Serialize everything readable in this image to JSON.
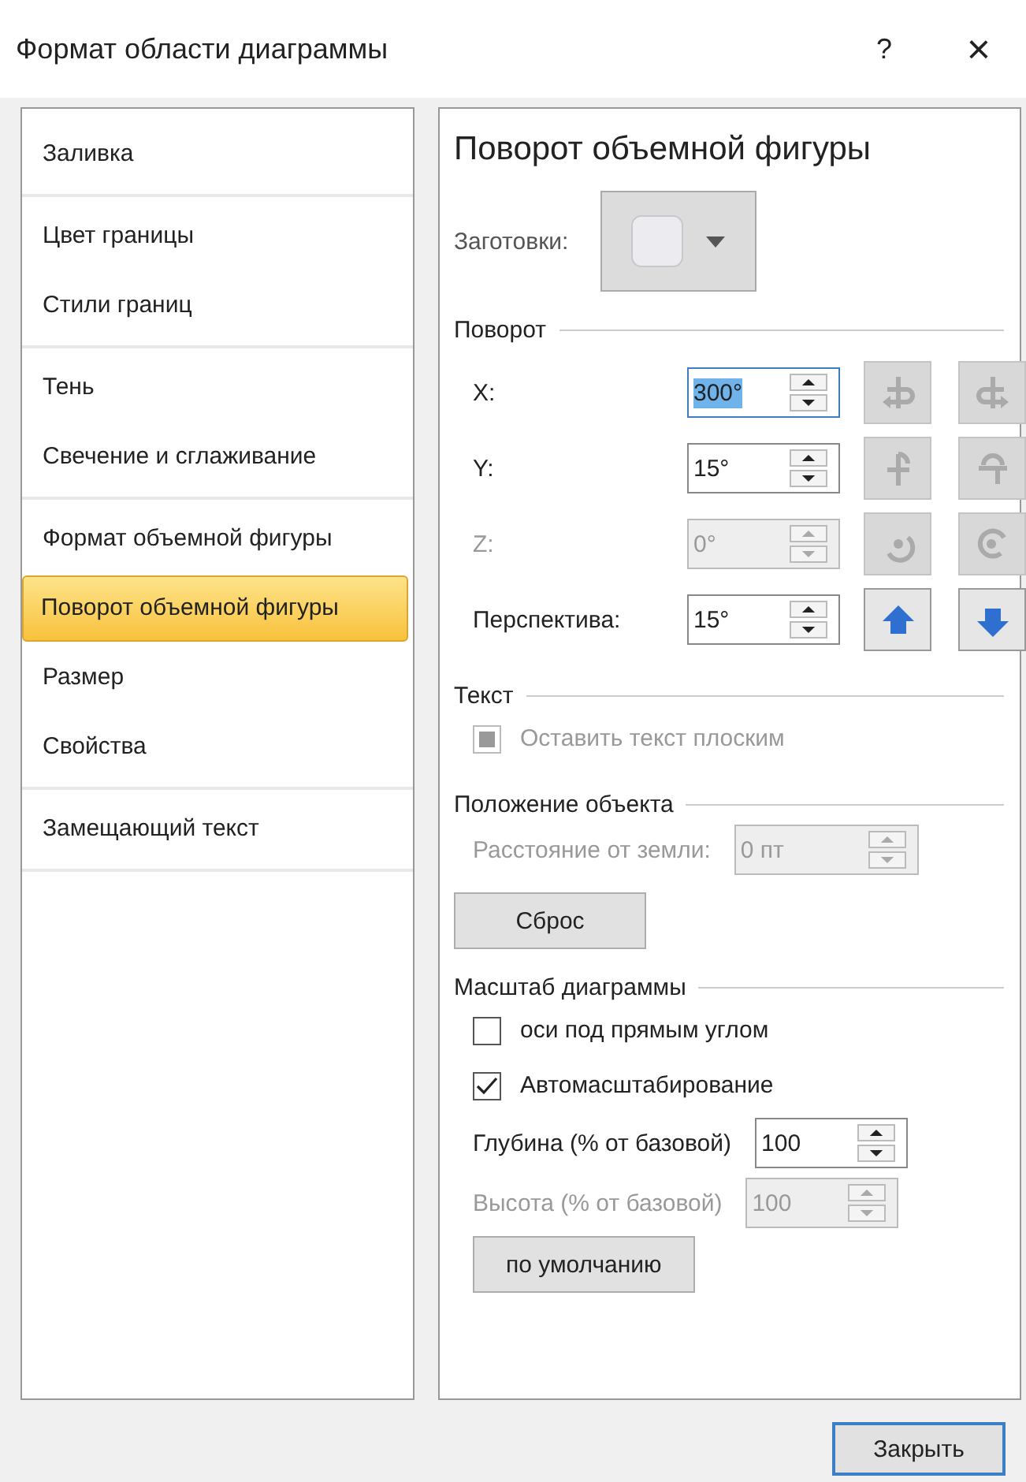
{
  "window": {
    "title": "Формат области диаграммы",
    "help": "?",
    "close": "×"
  },
  "sidebar": {
    "groups": [
      [
        {
          "label": "Заливка",
          "selected": false
        }
      ],
      [
        {
          "label": "Цвет границы",
          "selected": false
        },
        {
          "label": "Стили границ",
          "selected": false
        }
      ],
      [
        {
          "label": "Тень",
          "selected": false
        },
        {
          "label": "Свечение и сглаживание",
          "selected": false
        }
      ],
      [
        {
          "label": "Формат объемной фигуры",
          "selected": false
        },
        {
          "label": "Поворот объемной фигуры",
          "selected": true
        },
        {
          "label": "Размер",
          "selected": false
        },
        {
          "label": "Свойства",
          "selected": false
        }
      ],
      [
        {
          "label": "Замещающий текст",
          "selected": false
        }
      ]
    ]
  },
  "panel": {
    "title": "Поворот объемной фигуры",
    "presets": {
      "label": "Заготовки:"
    },
    "sections": [
      {
        "title": "Поворот",
        "items": [
          {
            "kind": "rotation_x",
            "label": "X:",
            "value": "300°",
            "value_selected": true,
            "disabled": false,
            "buttons_disabled": true
          },
          {
            "kind": "rotation_y",
            "label": "Y:",
            "value": "15°",
            "value_selected": false,
            "disabled": false,
            "buttons_disabled": true
          },
          {
            "kind": "rotation_z",
            "label": "Z:",
            "value": "0°",
            "value_selected": false,
            "disabled": true,
            "buttons_disabled": true
          },
          {
            "kind": "rotation_perspective",
            "label": "Перспектива:",
            "value": "15°",
            "value_selected": false,
            "disabled": false,
            "buttons_disabled": false
          }
        ]
      },
      {
        "title": "Текст",
        "items": [
          {
            "kind": "checkbox",
            "label": "Оставить текст плоским",
            "indeterminate": true,
            "disabled": true
          }
        ]
      },
      {
        "title": "Положение объекта",
        "items": [
          {
            "kind": "spin",
            "label": "Расстояние от земли:",
            "value": "0 пт",
            "disabled": true
          },
          {
            "kind": "button",
            "label": "Сброс",
            "wide": true
          }
        ]
      },
      {
        "title": "Масштаб диаграммы",
        "items": [
          {
            "kind": "checkbox",
            "label": "оси под прямым углом",
            "checked": false,
            "disabled": false
          },
          {
            "kind": "checkbox",
            "label": "Автомасштабирование",
            "checked": true,
            "disabled": false
          },
          {
            "kind": "spin",
            "label": "Глубина (% от базовой)",
            "value": "100",
            "disabled": false
          },
          {
            "kind": "spin",
            "label": "Высота (% от базовой)",
            "value": "100",
            "disabled": true
          },
          {
            "kind": "button",
            "label": "по умолчанию",
            "wide": false
          }
        ]
      }
    ]
  },
  "footer": {
    "close_button": "Закрыть"
  }
}
